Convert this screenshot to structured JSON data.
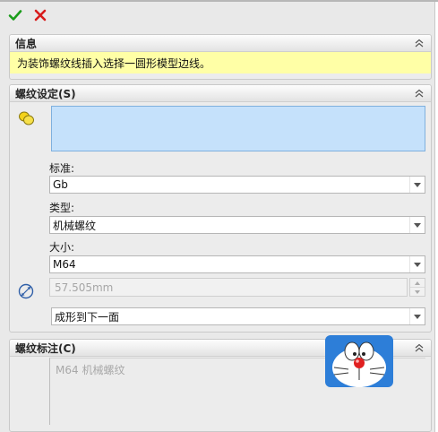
{
  "toolbar": {
    "ok_icon": "checkmark-icon",
    "cancel_icon": "cross-icon"
  },
  "info_section": {
    "title": "信息",
    "message": "为装饰螺纹线插入选择一圆形模型边线。"
  },
  "thread_settings": {
    "title": "螺纹设定(S)",
    "edge_icon": "circular-edge-icon",
    "edge_selection_value": "",
    "standard_label": "标准:",
    "standard_value": "Gb",
    "type_label": "类型:",
    "type_value": "机械螺纹",
    "size_label": "大小:",
    "size_value": "M64",
    "diameter_icon": "diameter-icon",
    "diameter_value": "57.505mm",
    "end_condition_value": "成形到下一面"
  },
  "thread_callout": {
    "title": "螺纹标注(C)",
    "callout_text": "M64 机械螺纹"
  },
  "colors": {
    "info_bg": "#ffffa6",
    "selection_bg": "#c5e1fb",
    "ok_green": "#1a9c1a",
    "cancel_red": "#d81c1c"
  }
}
